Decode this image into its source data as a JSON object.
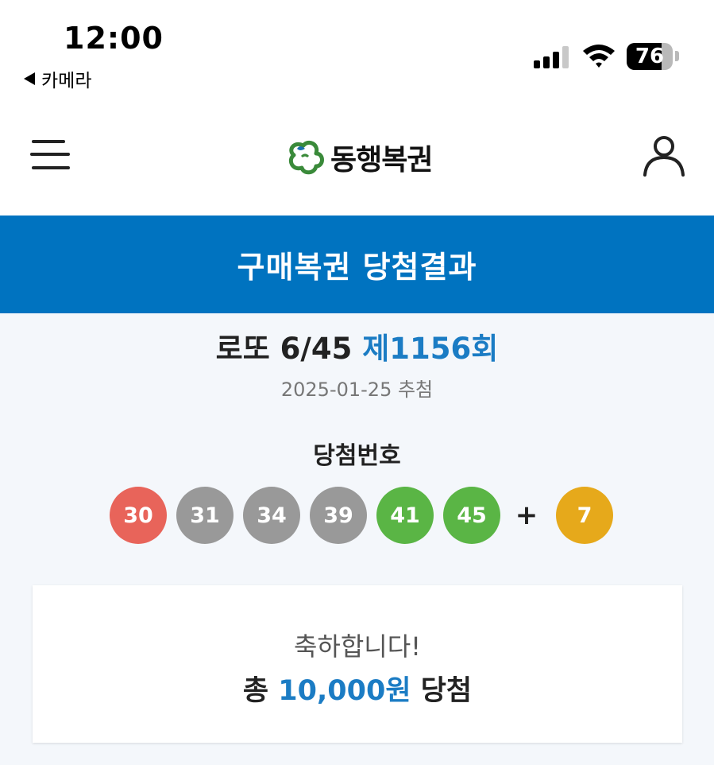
{
  "status_bar": {
    "time": "12:00",
    "back_app_label": "카메라",
    "battery_level": "76",
    "battery_fraction": 0.76
  },
  "header": {
    "logo_text": "동행복권",
    "menu_icon": "hamburger-menu-icon",
    "user_icon": "user-icon",
    "logo_icon": "clover-logo-icon"
  },
  "banner": {
    "title": "구매복권 당첨결과"
  },
  "result": {
    "game_name": "로또 6/45",
    "round": "제1156회",
    "draw_date": "2025-01-25 추첨",
    "numbers_label": "당첨번호",
    "numbers": [
      {
        "value": "30",
        "color": "#e8645a"
      },
      {
        "value": "31",
        "color": "#999999"
      },
      {
        "value": "34",
        "color": "#999999"
      },
      {
        "value": "39",
        "color": "#999999"
      },
      {
        "value": "41",
        "color": "#5ab545"
      },
      {
        "value": "45",
        "color": "#5ab545"
      }
    ],
    "plus": "+",
    "bonus": {
      "value": "7",
      "color": "#e6a91b"
    }
  },
  "card": {
    "congrats": "축하합니다!",
    "prize_prefix": "총",
    "prize_amount": "10,000원",
    "prize_suffix": "당첨"
  },
  "colors": {
    "brand_blue": "#0073c0",
    "accent_blue": "#1b7cc4",
    "background": "#f4f7fb"
  }
}
